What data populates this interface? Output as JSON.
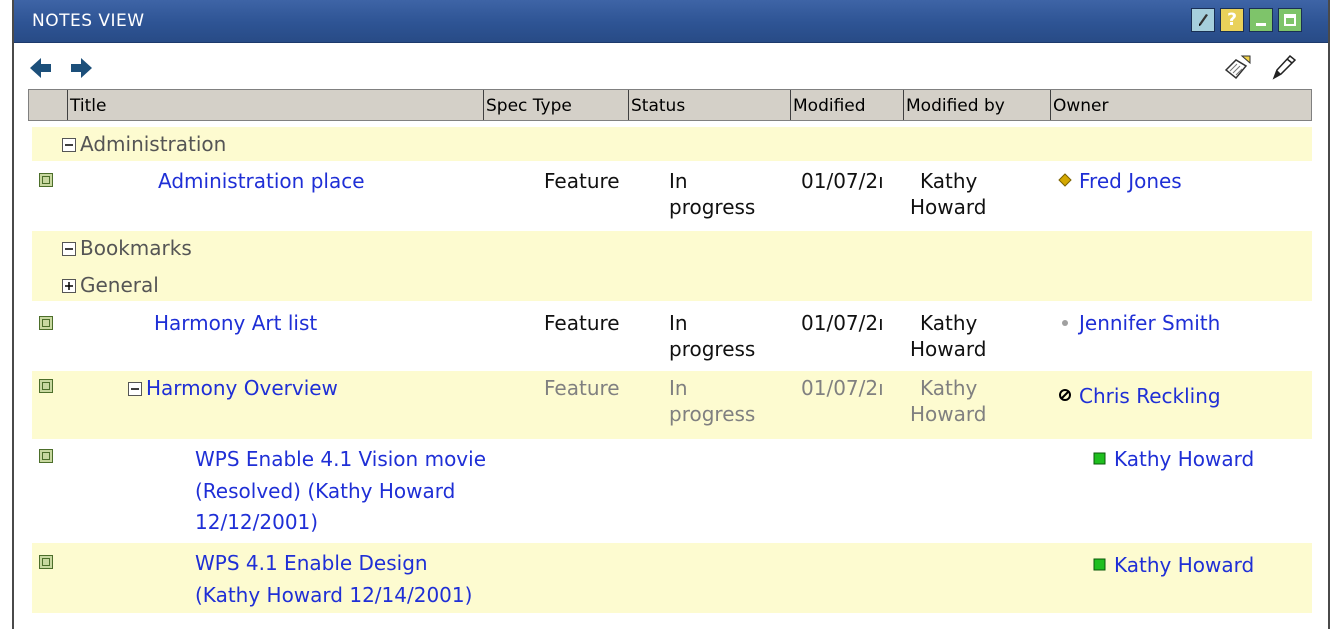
{
  "window": {
    "title": "NOTES VIEW",
    "buttons": {
      "edit": "edit-icon",
      "help": "?",
      "minimize": "minimize-icon",
      "maximize": "maximize-icon"
    }
  },
  "toolbar": {
    "back": "arrow-left-icon",
    "forward": "arrow-right-icon",
    "new_document": "new-document-icon",
    "edit_pen": "pen-icon"
  },
  "columns": [
    "Title",
    "Spec Type",
    "Status",
    "Modified",
    "Modified by",
    "Owner"
  ],
  "rows": [
    {
      "category": "Administration",
      "expanded": true
    },
    {
      "title": "Administration place",
      "spec_type": "Feature",
      "status": [
        "In",
        "progress"
      ],
      "modified": "01/07/2ı",
      "modified_by": [
        "Kathy",
        "Howard"
      ],
      "owner": "Fred Jones",
      "owner_icon": "yellow-diamond"
    },
    {
      "category": "Bookmarks",
      "expanded": true
    },
    {
      "category": "General",
      "expanded": false
    },
    {
      "title": "Harmony Art list",
      "spec_type": "Feature",
      "status": [
        "In",
        "progress"
      ],
      "modified": "01/07/2ı",
      "modified_by": [
        "Kathy",
        "Howard"
      ],
      "owner": "Jennifer Smith",
      "owner_icon": "grey-dot"
    },
    {
      "title": "Harmony Overview",
      "expanded": true,
      "spec_type": "Feature",
      "status": [
        "In",
        "progress"
      ],
      "modified": "01/07/2ı",
      "modified_by": [
        "Kathy",
        "Howard"
      ],
      "owner": "Chris Reckling",
      "owner_icon": "no-entry-circle"
    },
    {
      "title_lines": [
        "WPS Enable 4.1 Vision movie",
        "(Resolved) (Kathy Howard",
        "12/12/2001)"
      ],
      "owner": "Kathy Howard",
      "owner_icon": "green-square"
    },
    {
      "title_lines": [
        "WPS 4.1 Enable Design",
        "(Kathy Howard 12/14/2001)"
      ],
      "owner": "Kathy Howard",
      "owner_icon": "green-square"
    }
  ],
  "colors": {
    "titlebar": "#2e5494",
    "row_highlight": "#fdfbd0",
    "link": "#1f2fd6",
    "header_bg": "#d4d0c8"
  }
}
